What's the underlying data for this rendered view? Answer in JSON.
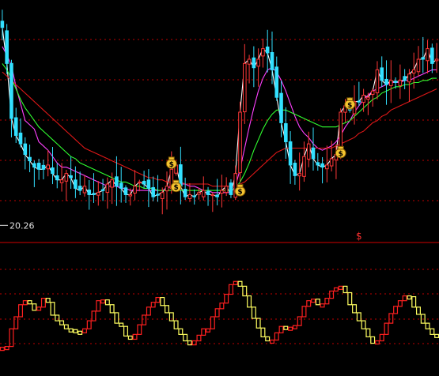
{
  "chart_data": [
    {
      "type": "candlestick",
      "panel": "price",
      "candle_count": 96,
      "colors": {
        "up": "#ff3838",
        "down": "#33e0ff",
        "background": "#000000",
        "grid": "#c00000"
      },
      "series": [
        {
          "values": [
            29.5,
            27.8,
            25.2,
            24.4,
            24.0,
            23.5,
            23.2,
            22.9,
            22.8,
            22.8,
            23.0,
            22.6,
            22.3,
            22.3,
            22.6,
            22.4,
            21.9,
            21.8,
            22.0,
            21.6,
            21.6,
            21.7,
            21.8,
            22.1,
            22.3,
            22.0,
            21.9,
            21.6,
            21.6,
            22.0,
            22.2,
            22.1,
            21.9,
            21.5,
            21.6,
            21.7,
            22.0,
            22.8,
            23.0,
            22.0,
            21.5,
            21.6,
            21.5,
            21.7,
            21.8,
            21.6,
            21.6,
            21.5,
            21.8,
            22.0,
            21.6,
            22.6,
            25.5,
            27.8,
            28.0,
            27.6,
            28.0,
            28.5,
            28.3,
            27.5,
            26.2,
            25.0,
            24.1,
            23.0,
            22.5,
            22.6,
            23.4,
            24.0,
            23.3,
            23.0,
            22.9,
            23.0,
            23.3,
            23.5,
            25.5,
            25.8,
            25.6,
            26.0,
            26.0,
            26.3,
            26.2,
            26.5,
            27.5,
            27.0,
            26.8,
            27.0,
            26.9,
            27.0,
            27.0,
            27.3,
            27.5,
            28.0,
            28.0,
            28.5,
            27.8,
            28.0
          ],
          "color": "#ffffff"
        },
        {
          "values": [
            28.6,
            28.2,
            27.7,
            26.7,
            25.9,
            25.1,
            24.9,
            24.7,
            24.1,
            23.9,
            23.7,
            23.4,
            23.1,
            22.9,
            22.9,
            22.8,
            22.7,
            22.6,
            22.5,
            22.4,
            22.3,
            22.2,
            22.1,
            22.0,
            22.0,
            22.0,
            21.9,
            21.9,
            21.8,
            21.8,
            21.8,
            21.8,
            21.8,
            21.8,
            21.8,
            21.8,
            21.9,
            22.0,
            22.1,
            22.1,
            22.1,
            22.0,
            22.0,
            21.9,
            21.8,
            21.8,
            21.7,
            21.7,
            21.7,
            21.7,
            21.7,
            22.0,
            22.8,
            23.8,
            24.8,
            25.7,
            26.5,
            27.1,
            27.5,
            27.6,
            27.4,
            27.0,
            26.5,
            25.9,
            25.3,
            24.8,
            24.5,
            24.3,
            24.0,
            23.8,
            23.7,
            23.8,
            23.9,
            24.1,
            24.4,
            24.8,
            25.1,
            25.5,
            25.8,
            26.1,
            26.3,
            26.5,
            26.6,
            26.7,
            26.8,
            26.9,
            26.9,
            26.9,
            27.0,
            27.0,
            27.1,
            27.2,
            27.3,
            27.4,
            27.5,
            27.5
          ],
          "color": "#ff40ff"
        },
        {
          "values": [
            27.8,
            27.5,
            27.1,
            26.6,
            26.1,
            25.7,
            25.4,
            25.1,
            24.8,
            24.6,
            24.4,
            24.2,
            24.0,
            23.8,
            23.6,
            23.4,
            23.3,
            23.1,
            23.0,
            22.9,
            22.8,
            22.7,
            22.6,
            22.5,
            22.4,
            22.3,
            22.2,
            22.2,
            22.1,
            22.0,
            22.0,
            21.9,
            21.9,
            21.9,
            21.8,
            21.8,
            21.8,
            21.8,
            21.8,
            21.8,
            21.8,
            21.8,
            21.8,
            21.8,
            21.8,
            21.8,
            21.8,
            21.8,
            21.8,
            21.8,
            21.8,
            21.9,
            22.2,
            22.6,
            23.1,
            23.7,
            24.2,
            24.7,
            25.1,
            25.4,
            25.6,
            25.6,
            25.6,
            25.5,
            25.4,
            25.3,
            25.2,
            25.1,
            25.0,
            24.9,
            24.8,
            24.8,
            24.8,
            24.8,
            24.9,
            25.0,
            25.1,
            25.3,
            25.5,
            25.7,
            25.9,
            26.1,
            26.2,
            26.4,
            26.5,
            26.6,
            26.7,
            26.7,
            26.8,
            26.8,
            26.9,
            26.9,
            27.0,
            27.0,
            27.1,
            27.1
          ],
          "color": "#30ff30"
        },
        {
          "values": [
            27.4,
            27.2,
            27.0,
            26.8,
            26.6,
            26.4,
            26.2,
            26.0,
            25.8,
            25.6,
            25.4,
            25.2,
            25.0,
            24.8,
            24.6,
            24.4,
            24.2,
            24.0,
            23.8,
            23.7,
            23.6,
            23.5,
            23.4,
            23.3,
            23.2,
            23.1,
            23.0,
            22.9,
            22.8,
            22.7,
            22.6,
            22.5,
            22.4,
            22.4,
            22.3,
            22.3,
            22.2,
            22.2,
            22.2,
            22.2,
            22.1,
            22.1,
            22.1,
            22.1,
            22.1,
            22.1,
            22.0,
            22.0,
            22.0,
            22.0,
            22.0,
            22.0,
            22.1,
            22.2,
            22.4,
            22.6,
            22.8,
            23.0,
            23.2,
            23.4,
            23.6,
            23.7,
            23.8,
            23.8,
            23.8,
            23.8,
            23.8,
            23.8,
            23.8,
            23.8,
            23.8,
            23.8,
            23.8,
            23.9,
            24.0,
            24.1,
            24.2,
            24.3,
            24.5,
            24.6,
            24.8,
            25.0,
            25.1,
            25.3,
            25.4,
            25.6,
            25.7,
            25.8,
            25.9,
            26.0,
            26.1,
            26.2,
            26.3,
            26.4,
            26.5,
            26.6
          ],
          "color": "#e01818"
        }
      ],
      "annotations": [
        {
          "text": "20.26",
          "x": 0,
          "y": 20.26
        }
      ],
      "signals": [
        {
          "icon": "money-bag-icon",
          "text": "$",
          "x": 37,
          "y": 23.1
        },
        {
          "icon": "money-bag-icon",
          "text": "$",
          "x": 38,
          "y": 22.0
        },
        {
          "icon": "money-bag-icon",
          "text": "$",
          "x": 52,
          "y": 21.8
        },
        {
          "icon": "money-bag-icon",
          "text": "$",
          "x": 76,
          "y": 25.9
        },
        {
          "icon": "money-bag-icon",
          "text": "$",
          "x": 74,
          "y": 23.6
        }
      ]
    },
    {
      "type": "step-oscillator",
      "panel": "indicator",
      "colors": {
        "rising": "#ff2020",
        "falling": "#ffff60"
      },
      "series": [
        {
          "values": [
            2.2,
            2.3,
            4.5,
            6.0,
            7.5,
            8.0,
            7.6,
            6.8,
            7.2,
            8.3,
            7.8,
            6.2,
            5.5,
            5.0,
            4.5,
            4.4,
            4.2,
            4.0,
            4.5,
            5.5,
            6.7,
            8.0,
            8.1,
            7.5,
            6.5,
            5.2,
            4.8,
            3.6,
            3.2,
            3.8,
            5.0,
            6.2,
            7.2,
            7.8,
            8.4,
            7.4,
            6.5,
            5.5,
            4.5,
            3.8,
            3.0,
            2.5,
            3.0,
            3.7,
            4.5,
            4.5,
            6.0,
            7.0,
            7.7,
            8.8,
            10.0,
            10.4,
            9.8,
            8.6,
            7.2,
            5.8,
            4.6,
            3.5,
            3.0,
            3.1,
            4.0,
            4.8,
            4.6,
            4.7,
            4.9,
            6.0,
            7.3,
            8.0,
            8.2,
            7.5,
            7.6,
            8.3,
            9.2,
            9.6,
            9.8,
            9.0,
            7.5,
            6.5,
            5.5,
            4.5,
            3.5,
            2.7,
            3.0,
            3.8,
            5.2,
            6.4,
            7.3,
            8.0,
            8.6,
            8.5,
            7.2,
            6.3,
            5.2,
            4.5,
            3.8,
            3.5
          ],
          "color": "#ff2020"
        }
      ],
      "signals": [
        {
          "text": "$",
          "x": 78
        }
      ]
    }
  ]
}
